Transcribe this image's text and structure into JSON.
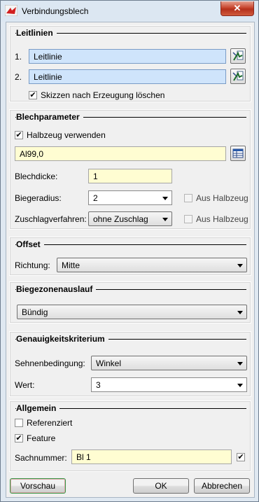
{
  "window": {
    "title": "Verbindungsblech",
    "close_symbol": "✕"
  },
  "leitlinien": {
    "title": "Leitlinien",
    "rows": [
      {
        "index": "1.",
        "value": "Leitlinie"
      },
      {
        "index": "2.",
        "value": "Leitlinie"
      }
    ],
    "delete_sketches": {
      "label": "Skizzen nach Erzeugung löschen",
      "checked": true
    }
  },
  "blechparameter": {
    "title": "Blechparameter",
    "use_semi": {
      "label": "Halbzeug verwenden",
      "checked": true
    },
    "material": "Al99,0",
    "thickness": {
      "label": "Blechdicke:",
      "value": "1"
    },
    "bend_radius": {
      "label": "Biegeradius:",
      "value": "2",
      "from_semi_label": "Aus Halbzeug",
      "from_semi_checked": false
    },
    "allowance": {
      "label": "Zuschlagverfahren:",
      "value": "ohne Zuschlag",
      "from_semi_label": "Aus Halbzeug",
      "from_semi_checked": false
    }
  },
  "offset": {
    "title": "Offset",
    "direction_label": "Richtung:",
    "direction_value": "Mitte"
  },
  "biegezonenauslauf": {
    "title": "Biegezonenauslauf",
    "value": "Bündig"
  },
  "genauigkeit": {
    "title": "Genauigkeitskriterium",
    "chord_label": "Sehnenbedingung:",
    "chord_value": "Winkel",
    "value_label": "Wert:",
    "value": "3"
  },
  "allgemein": {
    "title": "Allgemein",
    "referenced": {
      "label": "Referenziert",
      "checked": false
    },
    "feature": {
      "label": "Feature",
      "checked": true
    },
    "part_number": {
      "label": "Sachnummer:",
      "value": "Bl 1",
      "checked": true
    }
  },
  "buttons": {
    "preview": "Vorschau",
    "ok": "OK",
    "cancel": "Abbrechen"
  },
  "check_symbol": "✔"
}
